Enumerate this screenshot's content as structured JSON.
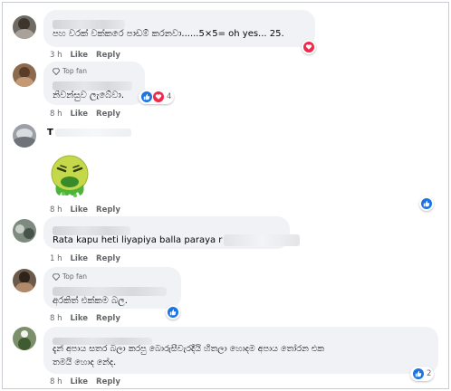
{
  "actions": {
    "like": "Like",
    "reply": "Reply"
  },
  "badge": {
    "top_fan": "Top fan"
  },
  "comments": [
    {
      "text": "පහ වරක් වක්කරෙ පාඩම් කරනවා......5×5= oh yes... 25.",
      "time": "3 h",
      "reactions": "love"
    },
    {
      "text": "නිවන්සුව ලැබේවා.",
      "time": "8 h",
      "reactions": "like-love",
      "count": "4"
    },
    {
      "initial": "T",
      "time": "8 h",
      "sticker": "vomiting-face-sticker"
    },
    {
      "text": "Rata kapu heti liyapiya balla paraya r",
      "time": "1 h"
    },
    {
      "text": "අරකිත් එක්කම බල.",
      "time": "8 h"
    },
    {
      "text_lines": [
        "දැන් අපාය සතර බලා කරපු බොරුසීවැරදීයි හිතලා හොදම අපාය තෝරන එක",
        "තමයි හොද නේද."
      ],
      "time": "8 h",
      "count": "2"
    }
  ],
  "colors": {
    "like": "#1b74e4",
    "love": "#f0284a",
    "bubble": "#f0f2f5",
    "meta": "#65676b"
  }
}
